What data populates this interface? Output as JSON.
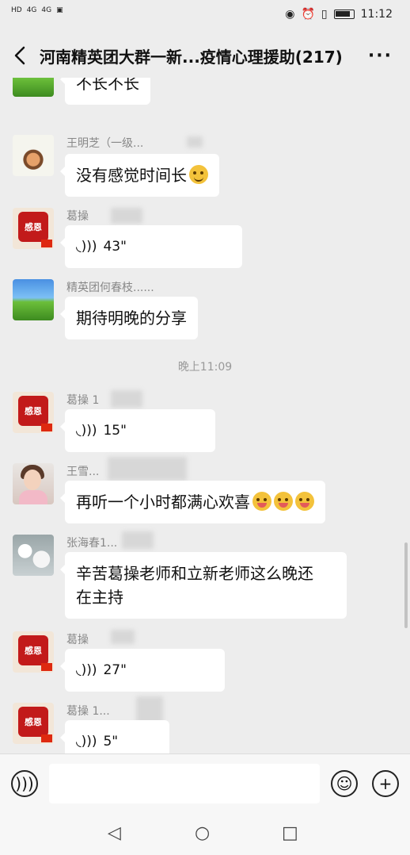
{
  "status_bar": {
    "sim1": "HD",
    "sim2": "HD",
    "signal1": "4G",
    "signal2": "4G",
    "time": "11:12"
  },
  "header": {
    "title": "河南精英团大群一新...疫情心理援助(217)",
    "more": "···"
  },
  "messages": [
    {
      "sender": "",
      "text": "不长不长"
    },
    {
      "sender": "王明芝（一级...",
      "text": "没有感觉时间长"
    },
    {
      "sender": "葛操",
      "duration": "43\""
    },
    {
      "sender": "精英团何春枝......",
      "text": "期待明晚的分享"
    },
    {
      "sender": "葛操 1",
      "duration": "15\""
    },
    {
      "sender": "王雪...",
      "text": "再听一个小时都满心欢喜"
    },
    {
      "sender": "张海春1...",
      "text_line1": "辛苦葛操老师和立新老师这么晚还",
      "text_line2": "在主持"
    },
    {
      "sender": "葛操",
      "duration": "27\""
    },
    {
      "sender": "葛操 1...",
      "duration": "5\""
    }
  ],
  "timestamp": "晚上11:09",
  "avatar_badge": "感恩",
  "input_bar": {
    "voice_icon": "voice-icon",
    "emoji_icon": "emoji-icon",
    "add_icon": "add-icon"
  },
  "nav": {
    "back": "◁",
    "home": "○",
    "recent": "□"
  }
}
